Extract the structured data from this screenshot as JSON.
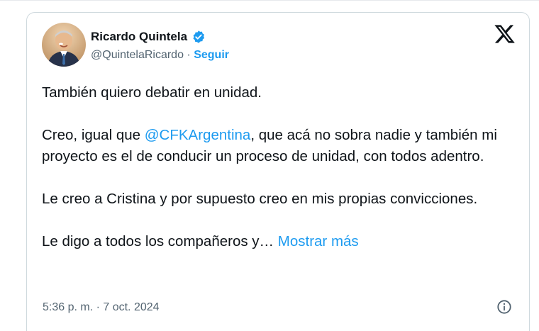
{
  "author": {
    "name": "Ricardo Quintela",
    "handle": "@QuintelaRicardo",
    "separator": "·",
    "follow_label": "Seguir",
    "avatar_icon": "profile-photo",
    "verified_icon": "verified-badge-icon"
  },
  "brand_icon": "x-logo-icon",
  "tweet": {
    "p1": "También quiero debatir en unidad.",
    "p2_before": "Creo, igual que ",
    "p2_mention": "@CFKArgentina",
    "p2_after": ", que acá no sobra nadie y también mi proyecto es el de conducir un proceso de unidad, con todos adentro.",
    "p3": "Le creo a Cristina y por supuesto creo en mis propias convicciones.",
    "p4_text": "Le digo a todos los compañeros y…",
    "show_more": "Mostrar más"
  },
  "meta": {
    "timestamp": "5:36 p. m. · 7 oct. 2024",
    "info_icon": "info-icon"
  },
  "colors": {
    "accent": "#1d9bf0",
    "text": "#0f1419",
    "secondary": "#536471",
    "border": "#cfd9de"
  }
}
